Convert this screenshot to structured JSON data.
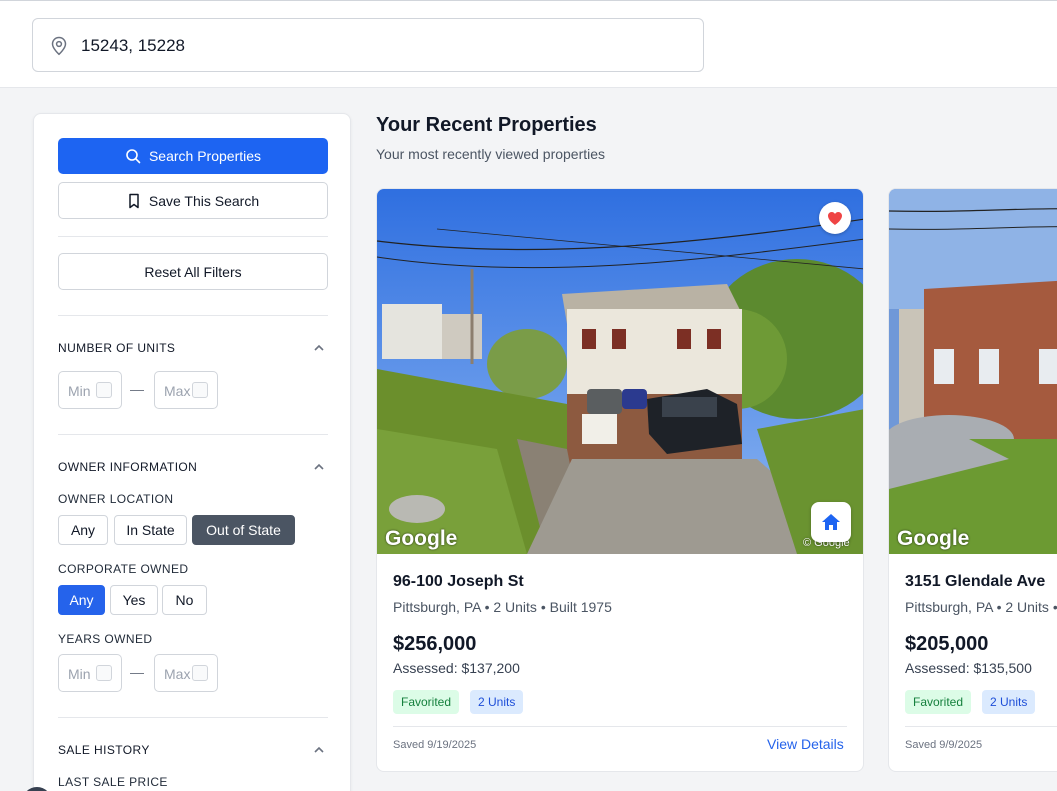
{
  "search": {
    "value": "15243, 15228"
  },
  "sidebar": {
    "search_button": "Search Properties",
    "save_button": "Save This Search",
    "reset_button": "Reset All Filters",
    "units": {
      "title": "NUMBER OF UNITS",
      "min_placeholder": "Min",
      "max_placeholder": "Max",
      "separator": "—"
    },
    "owner": {
      "title": "OWNER INFORMATION",
      "location_label": "OWNER LOCATION",
      "location_options": [
        "Any",
        "In State",
        "Out of State"
      ],
      "location_selected": "Out of State",
      "corporate_label": "CORPORATE OWNED",
      "corporate_options": [
        "Any",
        "Yes",
        "No"
      ],
      "corporate_selected": "Any",
      "years_label": "YEARS OWNED",
      "years_min_placeholder": "Min",
      "years_max_placeholder": "Max",
      "separator": "—"
    },
    "sale_history": {
      "title": "SALE HISTORY",
      "last_sale_label": "LAST SALE PRICE"
    }
  },
  "main": {
    "title": "Your Recent Properties",
    "subtitle": "Your most recently viewed properties"
  },
  "cards": [
    {
      "address": "96-100 Joseph St",
      "meta": "Pittsburgh, PA • 2 Units • Built 1975",
      "price": "$256,000",
      "assessed": "Assessed: $137,200",
      "badge_favorited": "Favorited",
      "badge_units": "2 Units",
      "saved": "Saved 9/19/2025",
      "view_link": "View Details",
      "watermark": "Google",
      "copyright": "© Google"
    },
    {
      "address": "3151 Glendale Ave",
      "meta": "Pittsburgh, PA • 2 Units •",
      "price": "$205,000",
      "assessed": "Assessed: $135,500",
      "badge_favorited": "Favorited",
      "badge_units": "2 Units",
      "saved": "Saved 9/9/2025",
      "watermark": "Google"
    }
  ],
  "colors": {
    "primary": "#1d64f2",
    "selected_dark": "#4b5563",
    "selected_blue": "#2563eb",
    "favorite_heart": "#ef4444",
    "link": "#2563eb"
  },
  "icons": [
    "map-pin-icon",
    "search-icon",
    "bookmark-icon",
    "chevron-up-icon",
    "heart-icon",
    "home-icon"
  ]
}
